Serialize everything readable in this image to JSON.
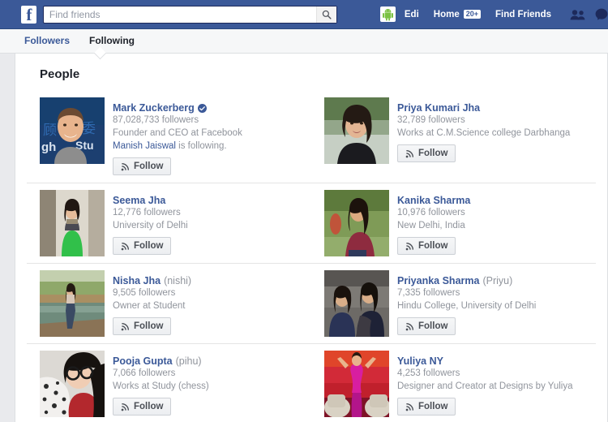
{
  "topbar": {
    "logo": "f",
    "search": {
      "placeholder": "Find friends",
      "value": "",
      "icon": "search-icon"
    },
    "profile_name": "Edi",
    "home_label": "Home",
    "home_badge": "20+",
    "find_friends_label": "Find Friends",
    "icons": [
      "friend-requests-icon",
      "messages-icon"
    ],
    "brand_color": "#3b5998"
  },
  "tabs": [
    {
      "label": "Followers",
      "active": false
    },
    {
      "label": "Following",
      "active": true
    }
  ],
  "main": {
    "section_title": "People",
    "follow_button_label": "Follow",
    "people": [
      {
        "name": "Mark Zuckerberg",
        "nickname": "",
        "verified": true,
        "followers": "87,028,733 followers",
        "subtitle": "Founder and CEO at Facebook",
        "mutual_name": "Manish Jaiswal",
        "mutual_suffix": " is following.",
        "photo": "mark-zuckerberg-photo"
      },
      {
        "name": "Priya Kumari Jha",
        "nickname": "",
        "verified": false,
        "followers": "32,789 followers",
        "subtitle": "Works at C.M.Science college Darbhanga",
        "mutual_name": "",
        "mutual_suffix": "",
        "photo": "priya-kumari-jha-photo"
      },
      {
        "name": "Seema Jha",
        "nickname": "",
        "verified": false,
        "followers": "12,776 followers",
        "subtitle": "University of Delhi",
        "mutual_name": "",
        "mutual_suffix": "",
        "photo": "seema-jha-photo"
      },
      {
        "name": "Kanika Sharma",
        "nickname": "",
        "verified": false,
        "followers": "10,976 followers",
        "subtitle": "New Delhi, India",
        "mutual_name": "",
        "mutual_suffix": "",
        "photo": "kanika-sharma-photo"
      },
      {
        "name": "Nisha Jha",
        "nickname": "(nishi)",
        "verified": false,
        "followers": "9,505 followers",
        "subtitle": "Owner at Student",
        "mutual_name": "",
        "mutual_suffix": "",
        "photo": "nisha-jha-photo"
      },
      {
        "name": "Priyanka Sharma",
        "nickname": "(Priyu)",
        "verified": false,
        "followers": "7,335 followers",
        "subtitle": "Hindu College, University of Delhi",
        "mutual_name": "",
        "mutual_suffix": "",
        "photo": "priyanka-sharma-photo"
      },
      {
        "name": "Pooja Gupta",
        "nickname": "(pihu)",
        "verified": false,
        "followers": "7,066 followers",
        "subtitle": "Works at Study (chess)",
        "mutual_name": "",
        "mutual_suffix": "",
        "photo": "pooja-gupta-photo"
      },
      {
        "name": "Yuliya NY",
        "nickname": "",
        "verified": false,
        "followers": "4,253 followers",
        "subtitle": "Designer and Creator at Designs by Yuliya",
        "mutual_name": "",
        "mutual_suffix": "",
        "photo": "yuliya-ny-photo"
      }
    ]
  }
}
